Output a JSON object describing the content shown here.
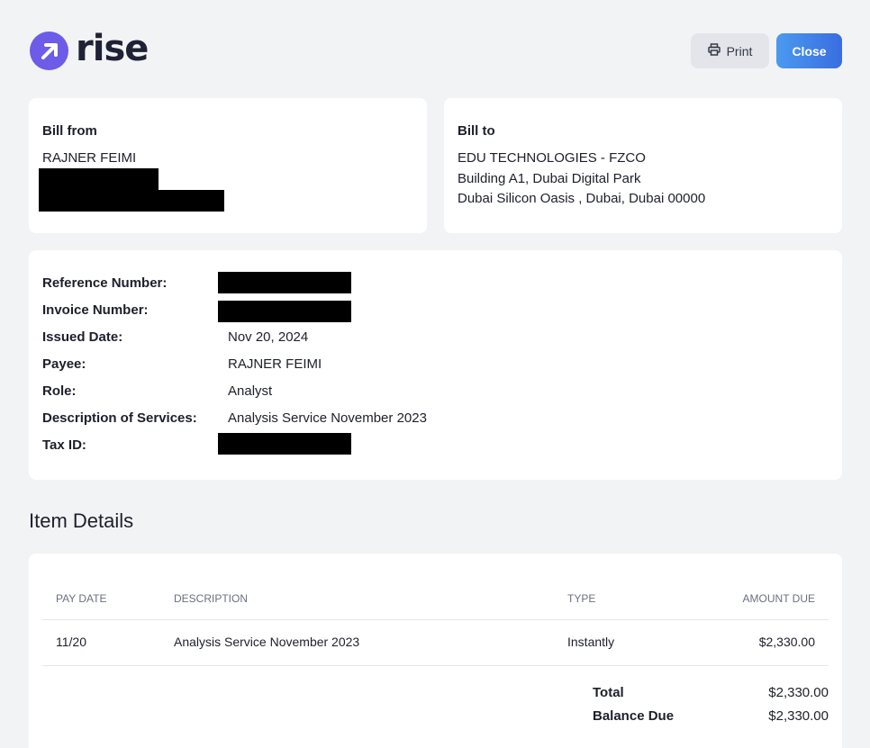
{
  "brand": {
    "name": "rise",
    "logo_color": "#6c5ce7"
  },
  "toolbar": {
    "print_label": "Print",
    "close_label": "Close"
  },
  "bill_from": {
    "title": "Bill from",
    "name": "RAJNER FEIMI"
  },
  "bill_to": {
    "title": "Bill to",
    "lines": [
      "EDU TECHNOLOGIES - FZCO",
      "Building A1, Dubai Digital Park",
      "Dubai Silicon Oasis , Dubai, Dubai 00000"
    ]
  },
  "details": {
    "reference_number": {
      "label": "Reference Number:",
      "value": ""
    },
    "invoice_number": {
      "label": "Invoice Number:",
      "value": ""
    },
    "issued_date": {
      "label": "Issued Date:",
      "value": "Nov 20, 2024"
    },
    "payee": {
      "label": "Payee:",
      "value": "RAJNER FEIMI"
    },
    "role": {
      "label": "Role:",
      "value": "Analyst"
    },
    "description": {
      "label": "Description of Services:",
      "value": "Analysis Service November 2023"
    },
    "tax_id": {
      "label": "Tax ID:",
      "value": ""
    }
  },
  "items": {
    "title": "Item Details",
    "headers": {
      "pay_date": "PAY DATE",
      "description": "DESCRIPTION",
      "type": "TYPE",
      "amount_due": "AMOUNT DUE"
    },
    "rows": [
      {
        "pay_date": "11/20",
        "description": "Analysis Service November 2023",
        "type": "Instantly",
        "amount_due": "$2,330.00"
      }
    ],
    "total": {
      "label": "Total",
      "value": "$2,330.00"
    },
    "balance_due": {
      "label": "Balance Due",
      "value": "$2,330.00"
    }
  },
  "colors": {
    "primary_button": "#3a6de0",
    "background": "#f2f3f5",
    "redaction": "#000000"
  }
}
